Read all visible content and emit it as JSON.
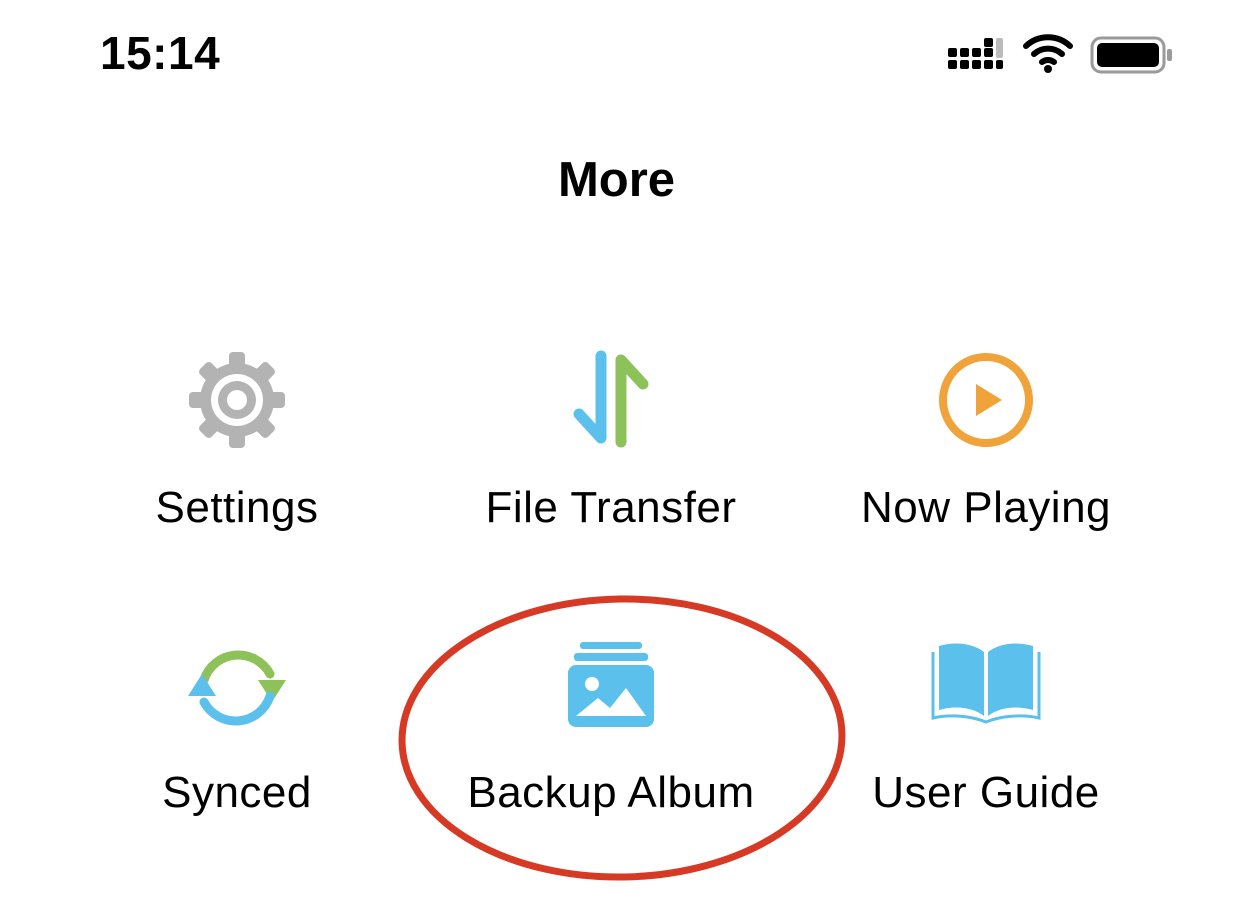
{
  "status_bar": {
    "time": "15:14",
    "signal_icon": "cellular-signal-icon",
    "wifi_icon": "wifi-icon",
    "battery_icon": "battery-icon"
  },
  "header": {
    "title": "More"
  },
  "menu": {
    "items": [
      {
        "label": "Settings",
        "icon": "gear-icon",
        "color": "#b3b3b3"
      },
      {
        "label": "File Transfer",
        "icon": "transfer-arrows-icon",
        "colors": [
          "#5bc1ec",
          "#8dc15a"
        ]
      },
      {
        "label": "Now Playing",
        "icon": "play-circle-icon",
        "color": "#f0a33a"
      },
      {
        "label": "Synced",
        "icon": "sync-icon",
        "colors": [
          "#5bc1ec",
          "#8dc15a"
        ]
      },
      {
        "label": "Backup Album",
        "icon": "photo-album-icon",
        "color": "#5bc1ec"
      },
      {
        "label": "User Guide",
        "icon": "open-book-icon",
        "color": "#5bc1ec"
      }
    ]
  },
  "annotation": {
    "highlight_color": "#d63a25",
    "highlighted_item": "Backup Album"
  }
}
